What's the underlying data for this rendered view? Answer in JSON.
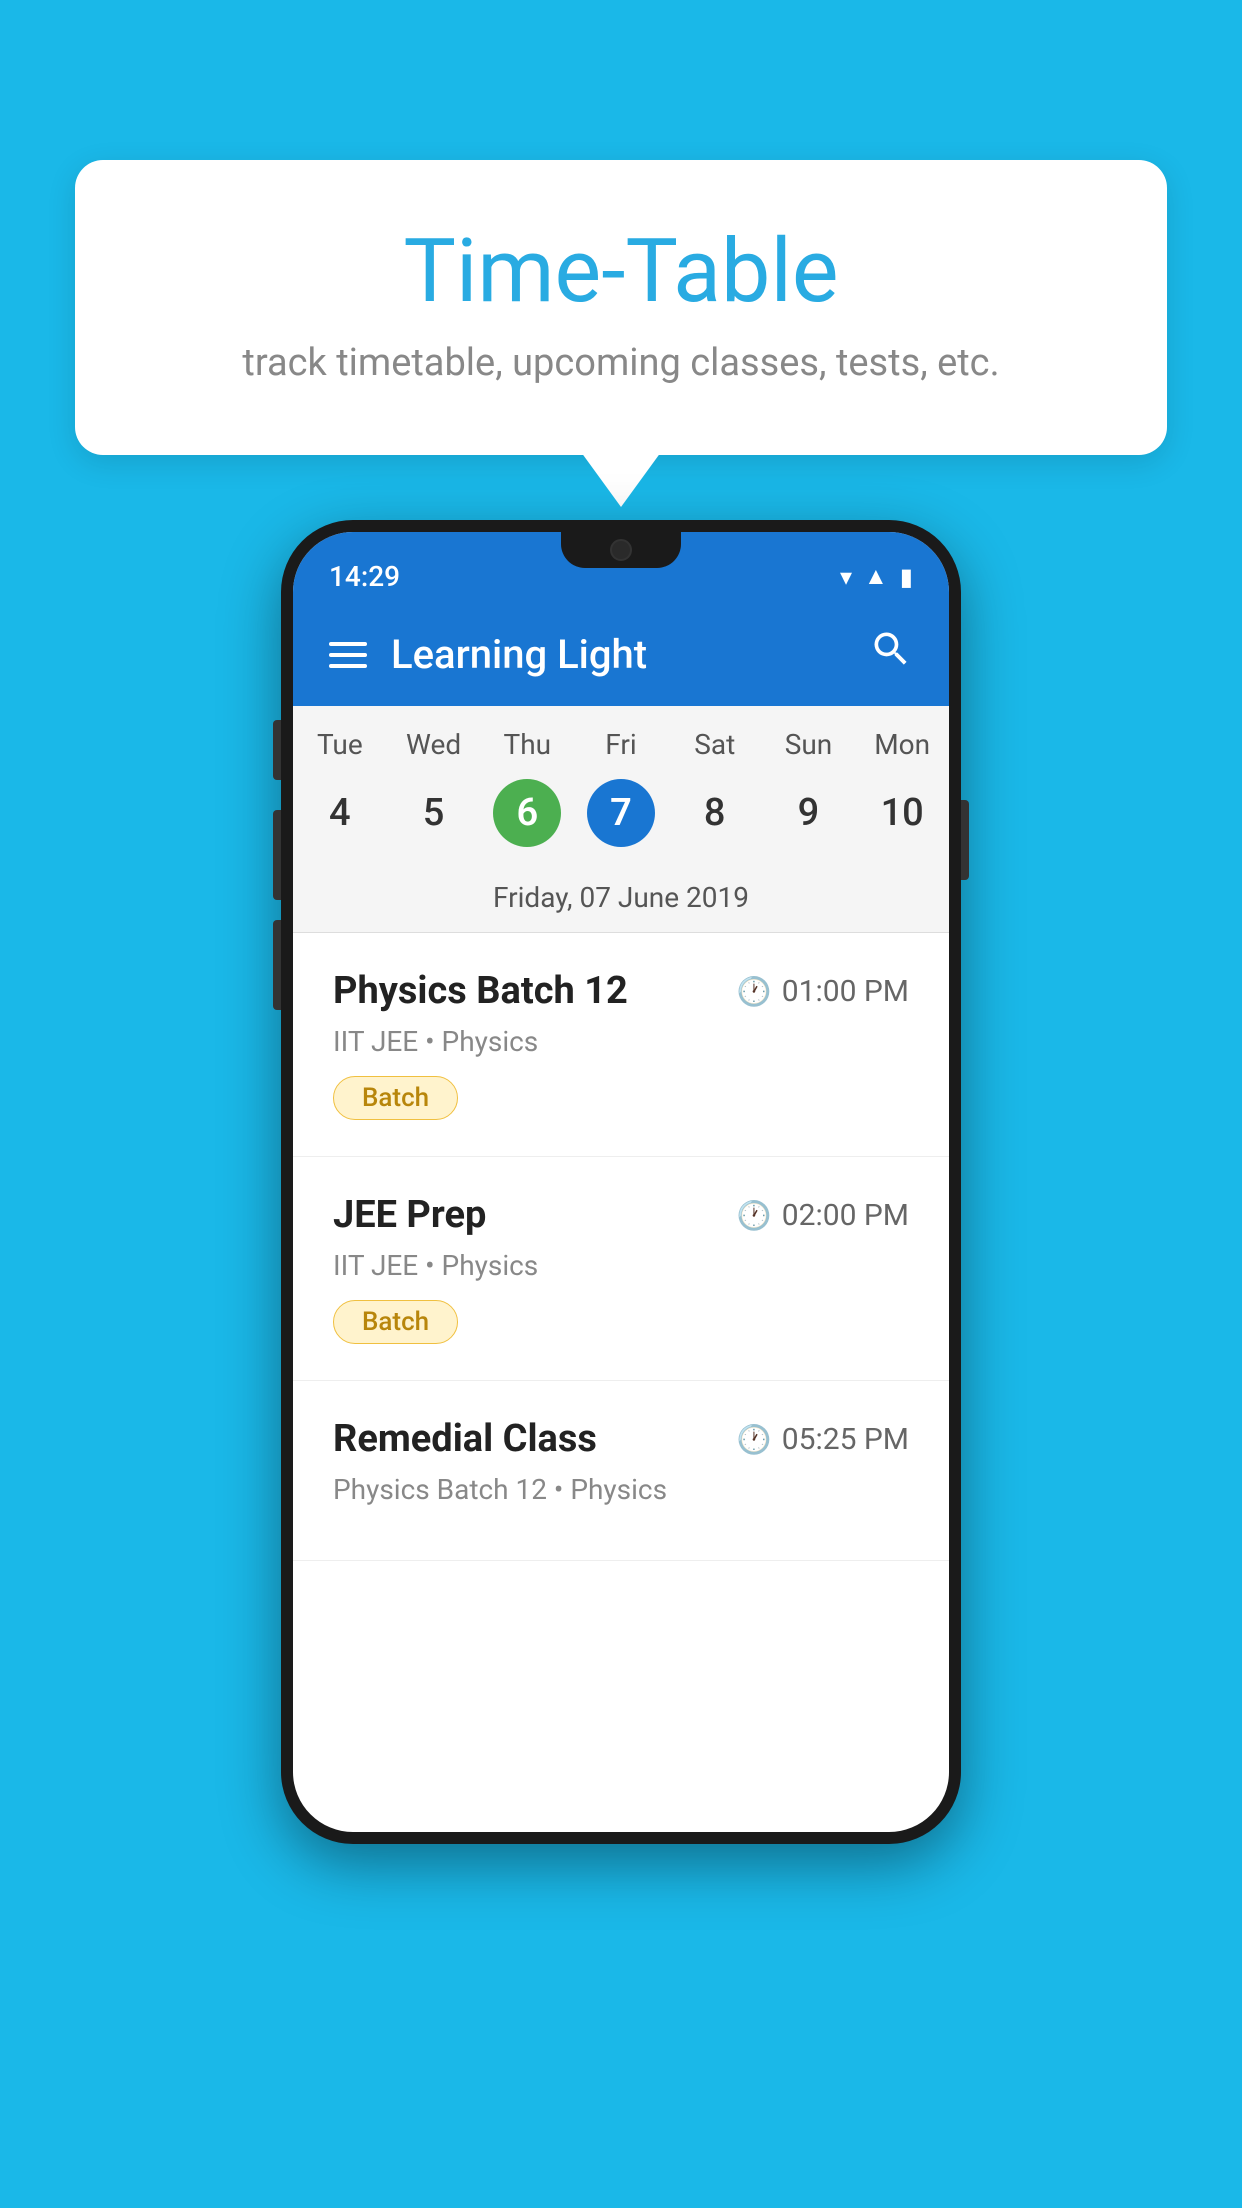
{
  "background_color": "#1ab8e8",
  "speech_bubble": {
    "title": "Time-Table",
    "subtitle": "track timetable, upcoming classes, tests, etc."
  },
  "phone": {
    "status_bar": {
      "time": "14:29",
      "icons": [
        "wifi",
        "signal",
        "battery"
      ]
    },
    "app_bar": {
      "title": "Learning Light",
      "menu_icon": "hamburger",
      "search_icon": "search"
    },
    "calendar": {
      "weekdays": [
        "Tue",
        "Wed",
        "Thu",
        "Fri",
        "Sat",
        "Sun",
        "Mon"
      ],
      "dates": [
        "4",
        "5",
        "6",
        "7",
        "8",
        "9",
        "10"
      ],
      "today_index": 2,
      "selected_index": 3,
      "selected_date_label": "Friday, 07 June 2019"
    },
    "schedule": [
      {
        "title": "Physics Batch 12",
        "time": "01:00 PM",
        "subtitle": "IIT JEE • Physics",
        "badge": "Batch"
      },
      {
        "title": "JEE Prep",
        "time": "02:00 PM",
        "subtitle": "IIT JEE • Physics",
        "badge": "Batch"
      },
      {
        "title": "Remedial Class",
        "time": "05:25 PM",
        "subtitle": "Physics Batch 12 • Physics",
        "badge": null
      }
    ]
  }
}
